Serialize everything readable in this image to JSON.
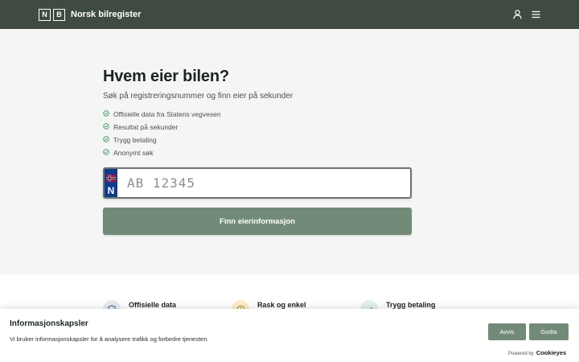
{
  "header": {
    "logo_letters": [
      "N",
      "B"
    ],
    "brand_name": "Norsk bilregister",
    "icons": [
      "user-icon",
      "menu-icon"
    ]
  },
  "hero": {
    "title": "Hvem eier bilen?",
    "subtitle": "Søk på registreringsnummer og finn eier på sekunder",
    "features": [
      "Offisielle data fra Statens vegvesen",
      "Resultat på sekunder",
      "Trygg betaling",
      "Anonymt søk"
    ],
    "feature_icon": "check-circle-icon"
  },
  "search": {
    "country_letter": "N",
    "plate_placeholder": "AB 12345",
    "button_label": "Finn eierinformasjon"
  },
  "feature_cards": [
    {
      "title": "Offisielle data",
      "icon": "shield-icon",
      "color": "#e6ebf2"
    },
    {
      "title": "Rask og enkel",
      "icon": "clock-icon",
      "color": "#fbeecb"
    },
    {
      "title": "Trygg betaling",
      "icon": "shield-check-icon",
      "color": "#e2f1e6"
    }
  ],
  "cookie_banner": {
    "title": "Informasjonskapsler",
    "text": "Vi bruker informasjonskapsler for å analysere trafikk og forbedre tjenesten.",
    "reject_label": "Avvis",
    "accept_label": "Godta",
    "powered_by": "Powered by",
    "provider": "Cookieyes"
  },
  "colors": {
    "header_bg": "#3f4a42",
    "accent": "#728b79",
    "plate_band": "#0c3b8f",
    "check": "#3f9a5a"
  }
}
